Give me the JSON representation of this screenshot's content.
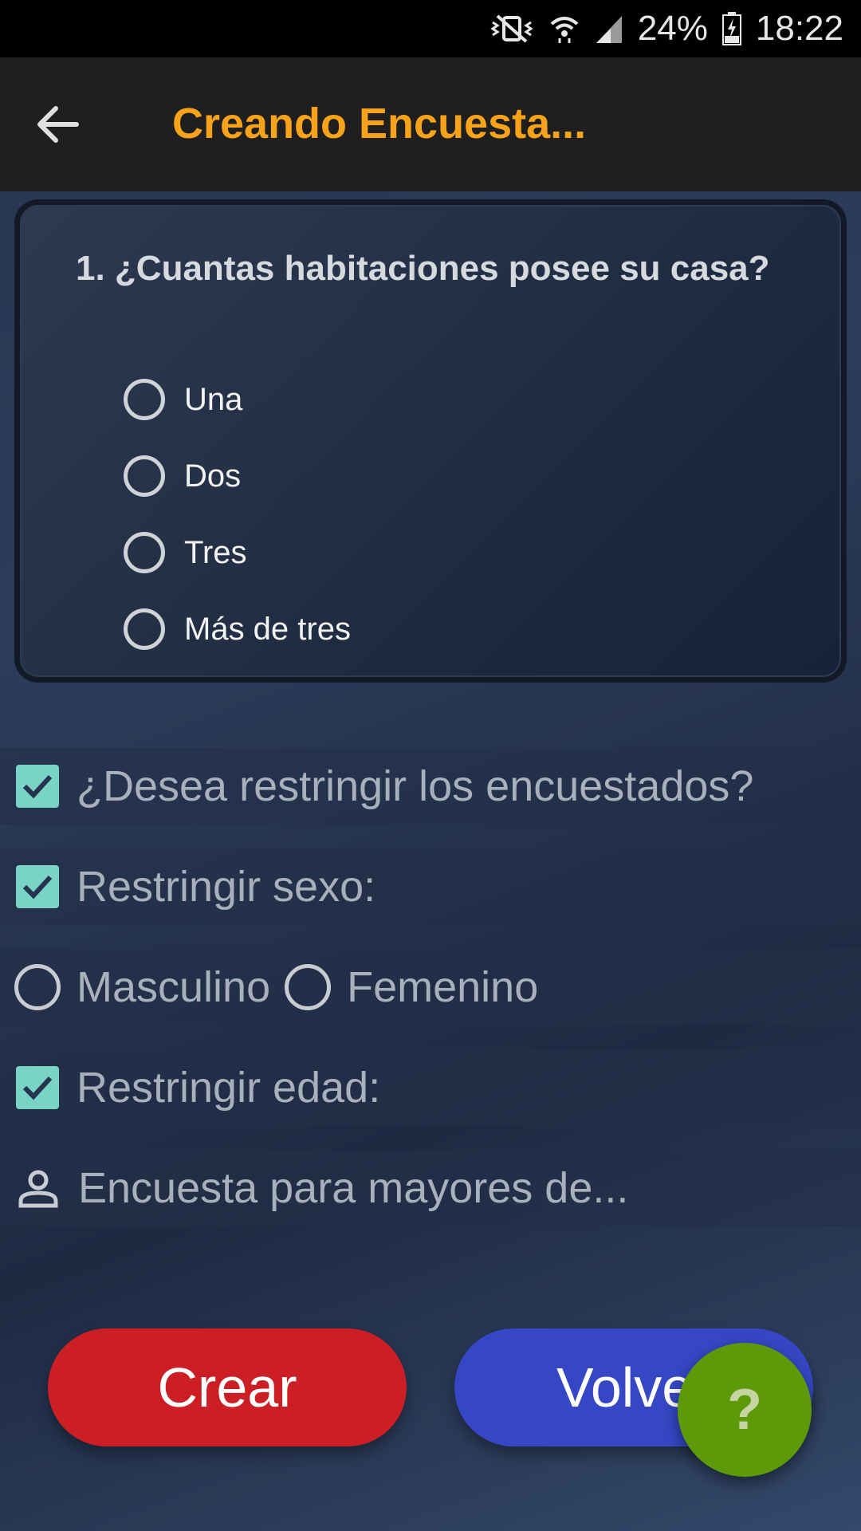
{
  "status_bar": {
    "battery": "24%",
    "time": "18:22"
  },
  "app_bar": {
    "title": "Creando Encuesta..."
  },
  "question": {
    "text": "1. ¿Cuantas habitaciones posee su casa?",
    "options": [
      "Una",
      "Dos",
      "Tres",
      "Más de tres"
    ]
  },
  "restrict": {
    "respondents_label": "¿Desea restringir los encuestados?",
    "sex_label": "Restringir sexo:",
    "male_label": "Masculino",
    "female_label": "Femenino",
    "age_label": "Restringir edad:",
    "age_placeholder": "Encuesta para mayores de..."
  },
  "buttons": {
    "create": "Crear",
    "back": "Volver",
    "help": "?"
  },
  "colors": {
    "title": "#f7a21b",
    "checkbox": "#79d4c5",
    "create_button": "#cc1f25",
    "back_button": "#3547c4",
    "help_fab": "#5d9a0a"
  }
}
